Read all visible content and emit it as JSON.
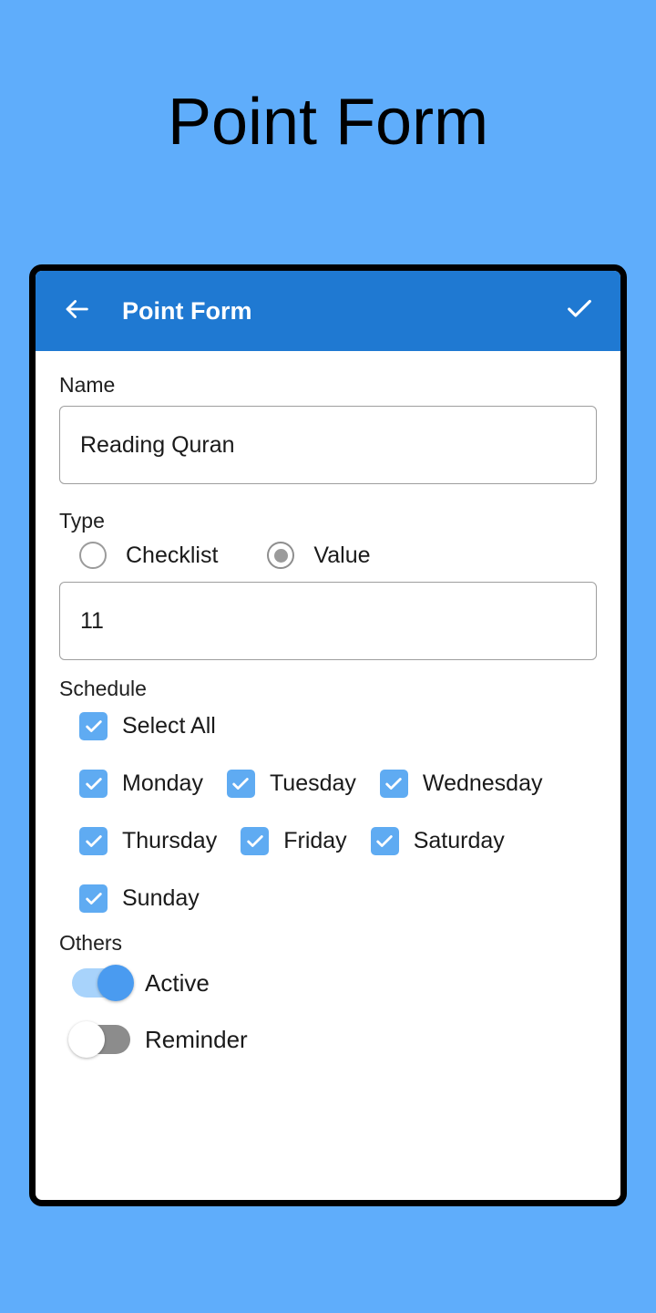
{
  "page": {
    "heading": "Point Form",
    "background_color": "#5fadfb"
  },
  "app_bar": {
    "title": "Point Form",
    "background_color": "#1f79d2",
    "back_icon": "arrow-left-icon",
    "action_icon": "check-icon"
  },
  "form": {
    "name": {
      "label": "Name",
      "value": "Reading Quran",
      "placeholder": "Name"
    },
    "type": {
      "label": "Type",
      "options": [
        {
          "label": "Checklist",
          "selected": false
        },
        {
          "label": "Value",
          "selected": true
        }
      ]
    },
    "value": {
      "value": "11",
      "placeholder": "Value"
    },
    "schedule": {
      "label": "Schedule",
      "select_all": {
        "label": "Select All",
        "checked": true
      },
      "days": [
        {
          "label": "Monday",
          "checked": true
        },
        {
          "label": "Tuesday",
          "checked": true
        },
        {
          "label": "Wednesday",
          "checked": true
        },
        {
          "label": "Thursday",
          "checked": true
        },
        {
          "label": "Friday",
          "checked": true
        },
        {
          "label": "Saturday",
          "checked": true
        },
        {
          "label": "Sunday",
          "checked": true
        }
      ],
      "checkbox_color": "#5fabf2"
    },
    "others": {
      "label": "Others",
      "toggles": [
        {
          "label": "Active",
          "on": true,
          "track_color": "#a8d3fb",
          "thumb_color": "#4a9bf0"
        },
        {
          "label": "Reminder",
          "on": false,
          "track_color": "#8c8c8c",
          "thumb_color": "#ffffff"
        }
      ]
    }
  }
}
